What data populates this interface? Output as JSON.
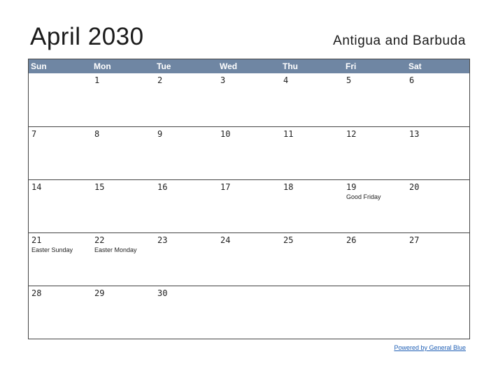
{
  "title": "April 2030",
  "country": "Antigua and Barbuda",
  "weekdays": [
    "Sun",
    "Mon",
    "Tue",
    "Wed",
    "Thu",
    "Fri",
    "Sat"
  ],
  "weeks": [
    [
      {
        "day": "",
        "holiday": ""
      },
      {
        "day": "1",
        "holiday": ""
      },
      {
        "day": "2",
        "holiday": ""
      },
      {
        "day": "3",
        "holiday": ""
      },
      {
        "day": "4",
        "holiday": ""
      },
      {
        "day": "5",
        "holiday": ""
      },
      {
        "day": "6",
        "holiday": ""
      }
    ],
    [
      {
        "day": "7",
        "holiday": ""
      },
      {
        "day": "8",
        "holiday": ""
      },
      {
        "day": "9",
        "holiday": ""
      },
      {
        "day": "10",
        "holiday": ""
      },
      {
        "day": "11",
        "holiday": ""
      },
      {
        "day": "12",
        "holiday": ""
      },
      {
        "day": "13",
        "holiday": ""
      }
    ],
    [
      {
        "day": "14",
        "holiday": ""
      },
      {
        "day": "15",
        "holiday": ""
      },
      {
        "day": "16",
        "holiday": ""
      },
      {
        "day": "17",
        "holiday": ""
      },
      {
        "day": "18",
        "holiday": ""
      },
      {
        "day": "19",
        "holiday": "Good Friday"
      },
      {
        "day": "20",
        "holiday": ""
      }
    ],
    [
      {
        "day": "21",
        "holiday": "Easter Sunday"
      },
      {
        "day": "22",
        "holiday": "Easter Monday"
      },
      {
        "day": "23",
        "holiday": ""
      },
      {
        "day": "24",
        "holiday": ""
      },
      {
        "day": "25",
        "holiday": ""
      },
      {
        "day": "26",
        "holiday": ""
      },
      {
        "day": "27",
        "holiday": ""
      }
    ],
    [
      {
        "day": "28",
        "holiday": ""
      },
      {
        "day": "29",
        "holiday": ""
      },
      {
        "day": "30",
        "holiday": ""
      },
      {
        "day": "",
        "holiday": ""
      },
      {
        "day": "",
        "holiday": ""
      },
      {
        "day": "",
        "holiday": ""
      },
      {
        "day": "",
        "holiday": ""
      }
    ]
  ],
  "footer": {
    "link_text": "Powered by General Blue"
  },
  "colors": {
    "header_bg": "#6f86a3",
    "header_text": "#ffffff",
    "grid_line": "#444444",
    "link": "#1f5fb5"
  }
}
